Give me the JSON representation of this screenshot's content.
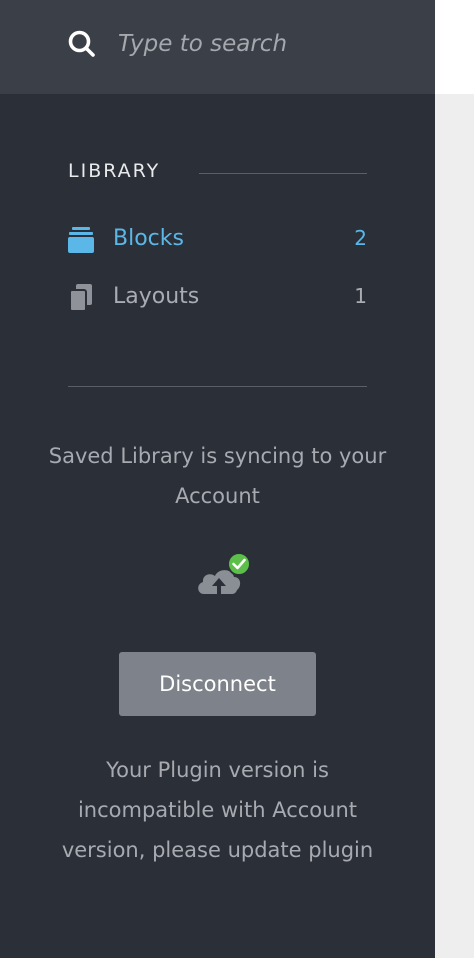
{
  "search": {
    "placeholder": "Type to search",
    "icon": "search-icon"
  },
  "library": {
    "title": "LIBRARY",
    "items": [
      {
        "label": "Blocks",
        "count": "2",
        "icon": "blocks-icon",
        "active": true
      },
      {
        "label": "Layouts",
        "count": "1",
        "icon": "layouts-icon",
        "active": false
      }
    ]
  },
  "sync": {
    "message": "Saved Library is syncing to your Account",
    "icon": "cloud-upload-check-icon"
  },
  "actions": {
    "disconnect_label": "Disconnect"
  },
  "notice": {
    "message": "Your Plugin version is incompatible with Account version, please update plugin"
  },
  "colors": {
    "sidebar_bg": "#2b2f37",
    "search_bg": "#3b3f47",
    "accent": "#5ab7e8",
    "success": "#5cbf4a",
    "button_bg": "#7e838b"
  }
}
